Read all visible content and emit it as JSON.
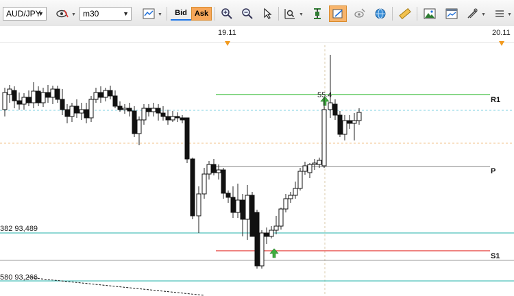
{
  "toolbar": {
    "symbol": "AUD/JPY",
    "timeframe": "m30",
    "bid_label": "Bid",
    "ask_label": "Ask"
  },
  "timeline": {
    "date1": "19.11",
    "date2": "20.11"
  },
  "chart": {
    "levels": {
      "r1": "R1",
      "p": "P",
      "s1": "S1"
    },
    "fib_label_1": "382 93,489",
    "fib_label_2": "580 93,266",
    "annotation": "55.4"
  },
  "colors": {
    "accent": "#f7a75a",
    "r1_line": "#43c043",
    "s1_line": "#e53935",
    "fib_line": "#20b2aa",
    "pivot_line": "#9a9a9a"
  }
}
